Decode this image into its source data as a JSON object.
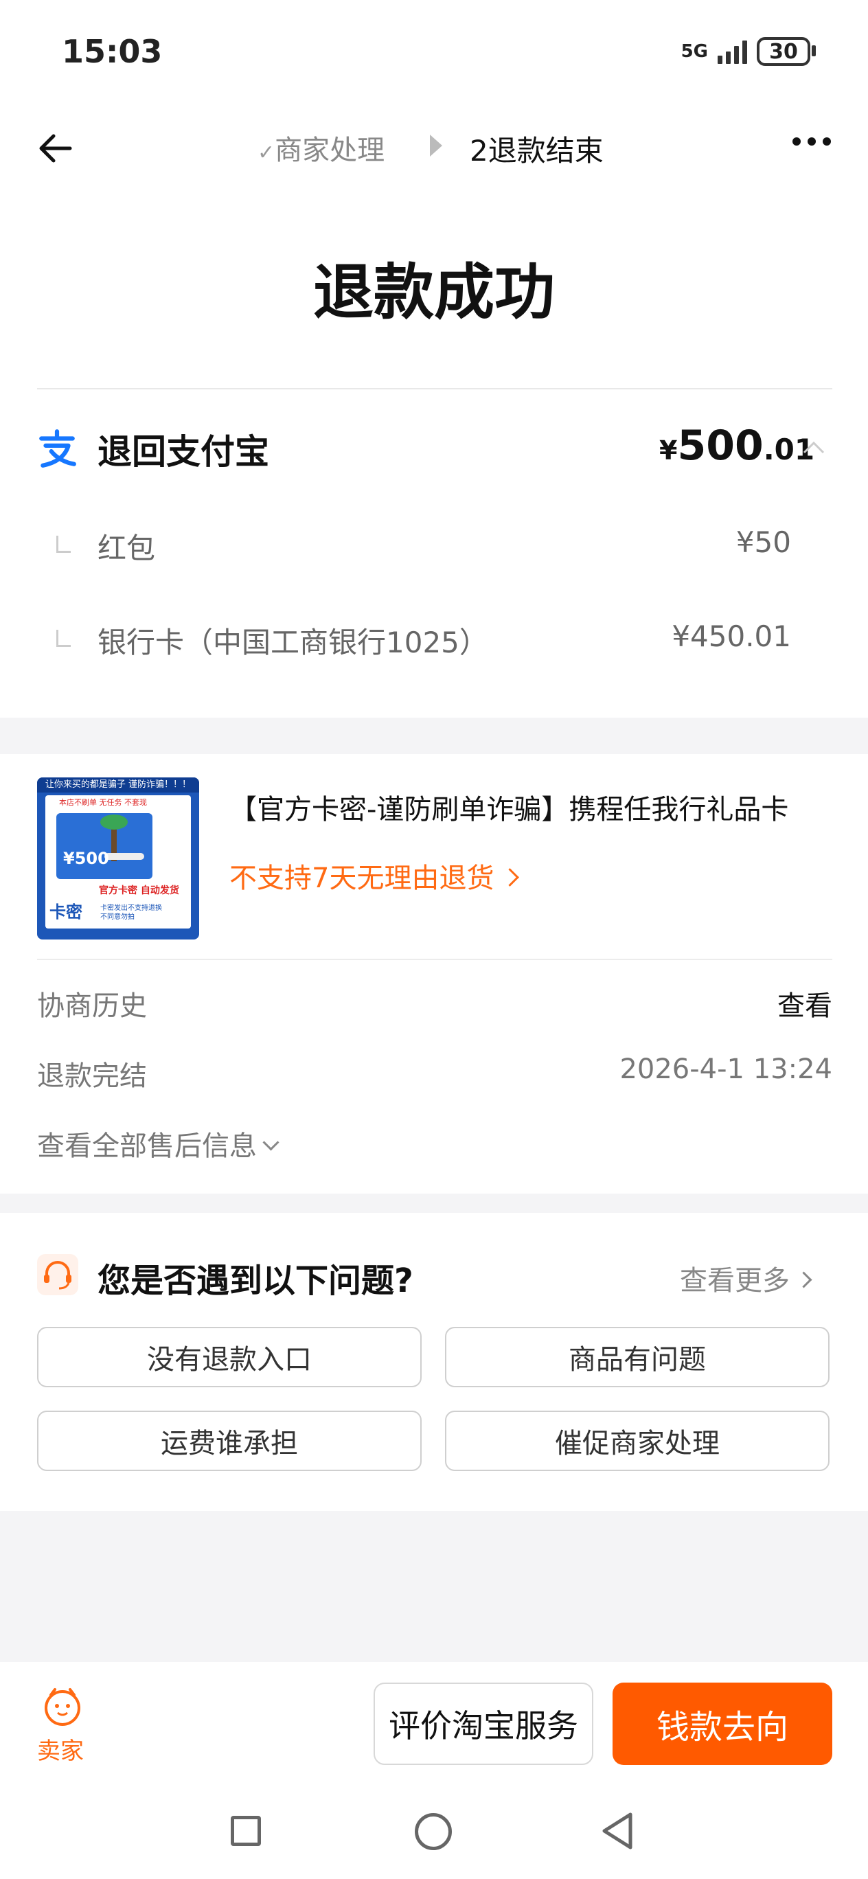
{
  "status_bar": {
    "time": "15:03",
    "network": "5G",
    "battery": "30"
  },
  "nav": {
    "step1": "商家处理",
    "step2": "2退款结束"
  },
  "result": {
    "title": "退款成功"
  },
  "refund": {
    "label": "退回支付宝",
    "currency": "¥",
    "amount_int": "500",
    "amount_dec": ".01",
    "breakdown": [
      {
        "label": "红包",
        "value": "¥50"
      },
      {
        "label": "银行卡（中国工商银行1025）",
        "value": "¥450.01"
      }
    ]
  },
  "product": {
    "title": "【官方卡密-谨防刷单诈骗】携程任我行礼品卡",
    "policy": "不支持7天无理由退货",
    "thumb": {
      "top": "让你来买的都是骗子 谨防诈骗！！！",
      "red": "本店不刷单  无任务  不套现",
      "value": "¥500",
      "official": "官方卡密  自动发货",
      "kami": "卡密",
      "note1": "卡密发出不支持退换",
      "note2": "不同意勿拍"
    },
    "rows": [
      {
        "label": "协商历史",
        "value": "查看"
      },
      {
        "label": "退款完结",
        "value": "2026-4-1 13:24"
      }
    ],
    "expand": "查看全部售后信息"
  },
  "help": {
    "title": "您是否遇到以下问题?",
    "more": "查看更多",
    "questions": [
      "没有退款入口",
      "商品有问题",
      "运费谁承担",
      "催促商家处理"
    ]
  },
  "bottom": {
    "seller": "卖家",
    "review": "评价淘宝服务",
    "money": "钱款去向"
  },
  "colors": {
    "accent": "#ff5a00",
    "alipay": "#1677ff"
  }
}
